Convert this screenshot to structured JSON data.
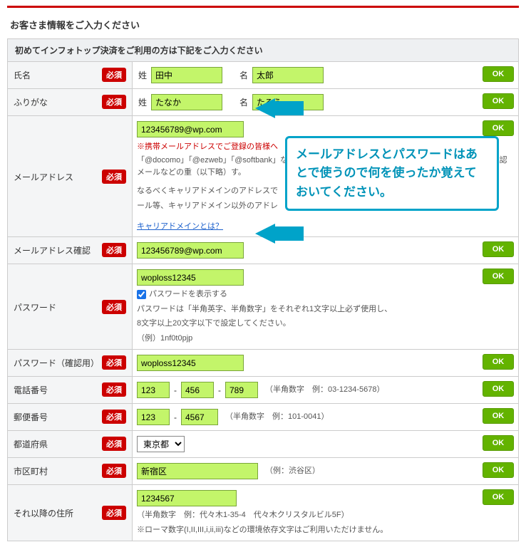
{
  "page": {
    "title": "お客さま情報をご入力ください",
    "section_head": "初めてインフォトップ決済をご利用の方は下記をご入力ください",
    "ok_label": "OK",
    "req_label": "必須"
  },
  "callout": {
    "text": "メールアドレスとパスワードはあとで使うので何を使ったか覚えておいてください。"
  },
  "fields": {
    "name": {
      "label": "氏名",
      "sei_label": "姓",
      "mei_label": "名",
      "sei_value": "田中",
      "mei_value": "太郎"
    },
    "furigana": {
      "label": "ふりがな",
      "sei_label": "姓",
      "mei_label": "名",
      "sei_value": "たなか",
      "mei_value": "たろう"
    },
    "email": {
      "label": "メールアドレス",
      "value": "123456789@wp.com",
      "red_note": "※携帯メールアドレスでご登録の皆様へ",
      "note1": "「@docomo」「@ezweb」「@softbank」などのキャリアドメインのアドレスを登録されますと、購入確認メールなどの重（以下略）す。",
      "note2_a": "なるべくキャリアドメインのアドレスで",
      "note2_b": "ール等、キャリアドメイン以外のアドレ",
      "link": "キャリアドメインとは？"
    },
    "email_confirm": {
      "label": "メールアドレス確認",
      "value": "123456789@wp.com"
    },
    "password": {
      "label": "パスワード",
      "value": "woploss12345",
      "show_label": "パスワードを表示する",
      "note1": "パスワードは「半角英字、半角数字」をそれぞれ1文字以上必ず使用し、",
      "note2": "8文字以上20文字以下で設定してください。",
      "note3": "（例）1nf0t0pjp"
    },
    "password_confirm": {
      "label": "パスワード（確認用）",
      "value": "woploss12345"
    },
    "tel": {
      "label": "電話番号",
      "p1": "123",
      "p2": "456",
      "p3": "789",
      "hint": "（半角数字　例：03-1234-5678）"
    },
    "zip": {
      "label": "郵便番号",
      "p1": "123",
      "p2": "4567",
      "hint": "（半角数字　例：101-0041）"
    },
    "pref": {
      "label": "都道府県",
      "value": "東京都"
    },
    "city": {
      "label": "市区町村",
      "value": "新宿区",
      "hint": "（例：渋谷区）"
    },
    "addr": {
      "label": "それ以降の住所",
      "value": "1234567",
      "hint1": "（半角数字　例：代々木1-35-4　代々木クリスタルビル5F）",
      "hint2": "※ローマ数字(I,II,III,i,ii,iii)などの環境依存文字はご利用いただけません。"
    }
  }
}
